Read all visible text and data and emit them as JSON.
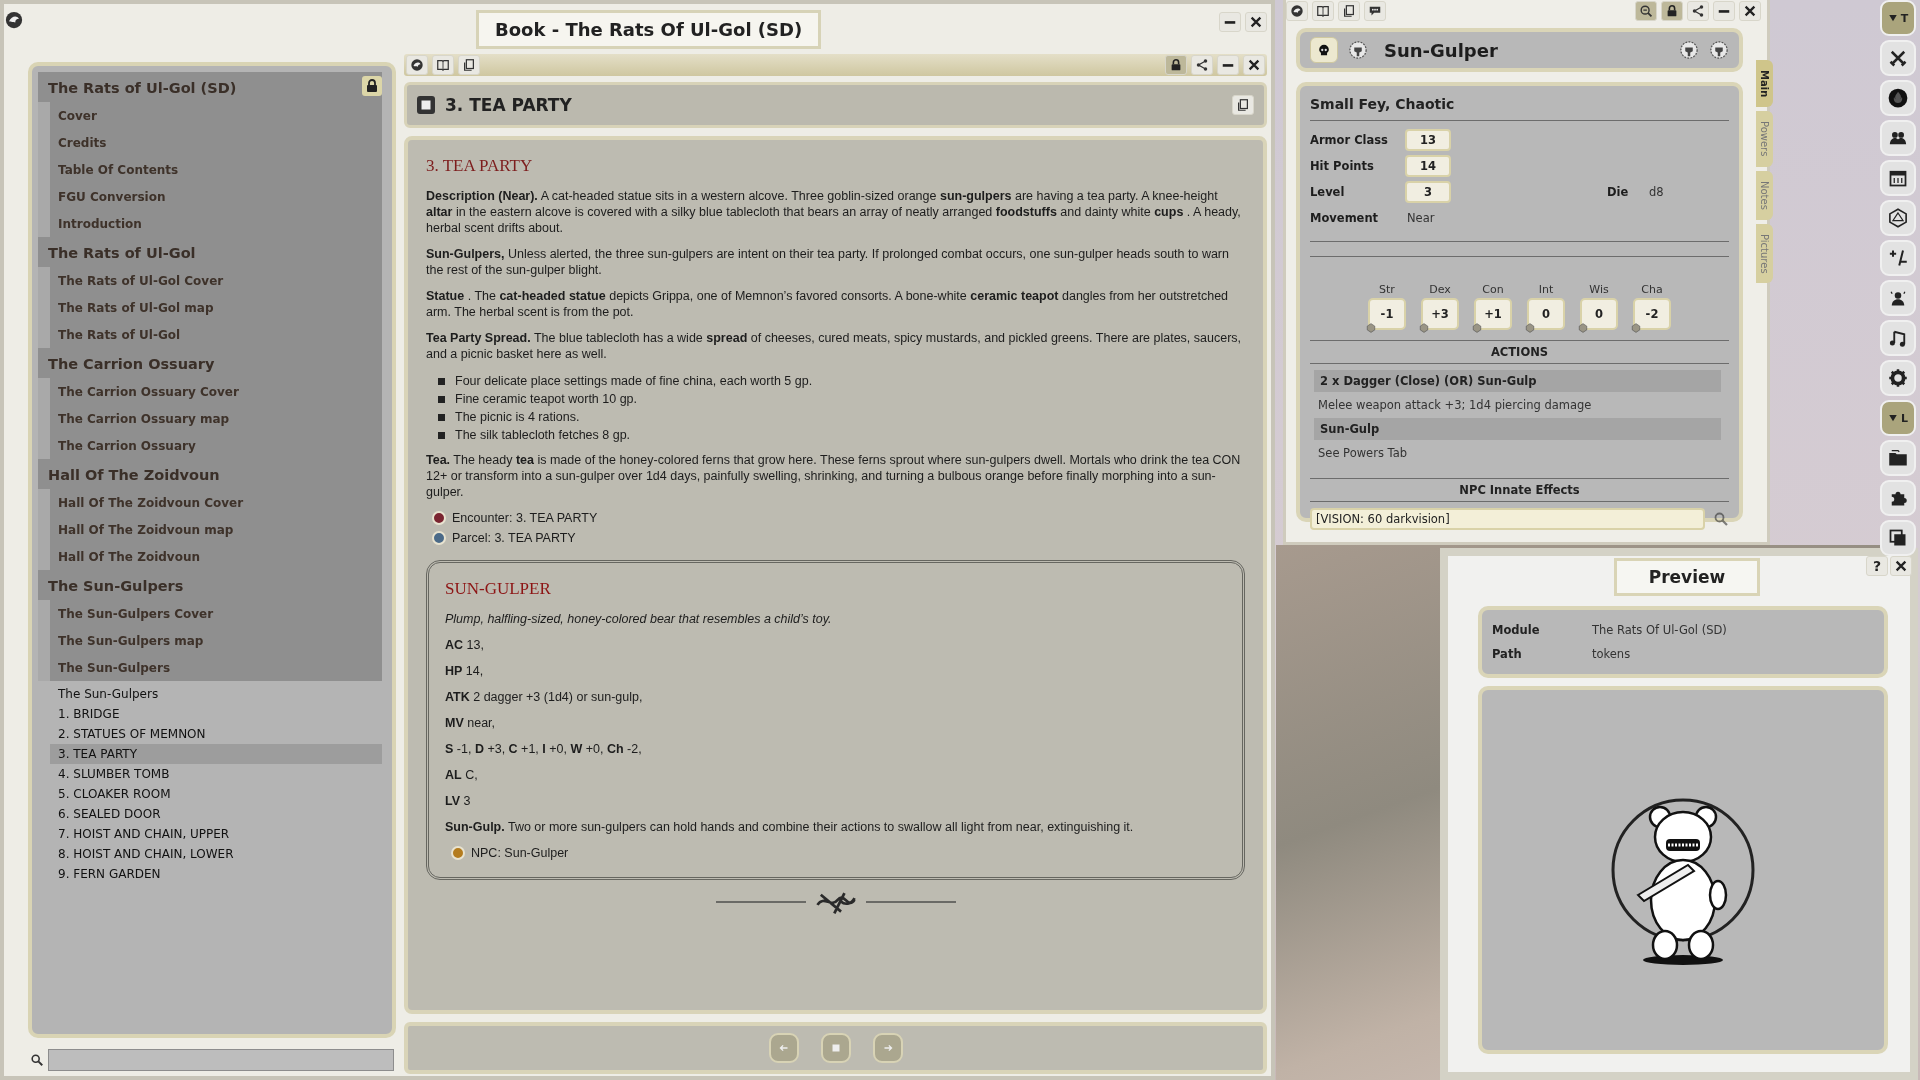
{
  "book": {
    "title": "Book - The Rats Of Ul-Gol (SD)",
    "index": [
      {
        "label": "The Rats of Ul-Gol (SD)",
        "children": [
          {
            "label": "Cover"
          },
          {
            "label": "Credits"
          },
          {
            "label": "Table Of Contents"
          },
          {
            "label": "FGU Conversion"
          },
          {
            "label": "Introduction"
          }
        ]
      },
      {
        "label": "The Rats of Ul-Gol",
        "children": [
          {
            "label": "The Rats of Ul-Gol Cover"
          },
          {
            "label": "The Rats of Ul-Gol map"
          },
          {
            "label": "The Rats of Ul-Gol"
          }
        ]
      },
      {
        "label": "The Carrion Ossuary",
        "children": [
          {
            "label": "The Carrion Ossuary Cover"
          },
          {
            "label": "The Carrion Ossuary map"
          },
          {
            "label": "The Carrion Ossuary"
          }
        ]
      },
      {
        "label": "Hall Of The Zoidvoun",
        "children": [
          {
            "label": "Hall Of The Zoidvoun Cover"
          },
          {
            "label": "Hall Of The Zoidvoun map"
          },
          {
            "label": "Hall Of The Zoidvoun"
          }
        ]
      },
      {
        "label": "The Sun-Gulpers",
        "children": [
          {
            "label": "The Sun-Gulpers Cover"
          },
          {
            "label": "The Sun-Gulpers map"
          },
          {
            "label": "The Sun-Gulpers",
            "children": [
              {
                "label": "The Sun-Gulpers",
                "selected": false
              },
              {
                "label": "1. BRIDGE",
                "selected": false
              },
              {
                "label": "2. STATUES OF MEMNON",
                "selected": false
              },
              {
                "label": "3. TEA PARTY",
                "selected": true
              },
              {
                "label": "4. SLUMBER TOMB",
                "selected": false
              },
              {
                "label": "5. CLOAKER ROOM",
                "selected": false
              },
              {
                "label": "6. SEALED DOOR",
                "selected": false
              },
              {
                "label": "7. HOIST AND CHAIN, UPPER",
                "selected": false
              },
              {
                "label": "8. HOIST AND CHAIN, LOWER",
                "selected": false
              },
              {
                "label": "9. FERN GARDEN",
                "selected": false
              }
            ]
          }
        ]
      }
    ],
    "page": {
      "title": "3. TEA PARTY",
      "blocks": [
        {
          "kind": "heading",
          "text": "3. TEA PARTY"
        },
        {
          "kind": "paragraph",
          "text": "**Description (Near).** A cat-headed statue sits in a western alcove. Three goblin-sized orange **sun-gulpers** are having a tea party. A knee-height **altar** in the eastern alcove is covered with a silky blue tablecloth that bears an array of neatly arranged **foodstuffs** and dainty white **cups** . A heady, herbal scent drifts about."
        },
        {
          "kind": "paragraph",
          "text": "**Sun-Gulpers,** Unless alerted, the three sun-gulpers are intent on their tea party. If prolonged combat occurs, one sun-gulper heads south to warn the rest of the sun-gulper blight."
        },
        {
          "kind": "paragraph",
          "text": "**Statue** . The **cat-headed statue** depicts Grippa, one of Memnon’s favored consorts. A bone-white **ceramic teapot** dangles from her outstretched arm. The herbal scent is from the pot."
        },
        {
          "kind": "paragraph",
          "text": "**Tea Party Spread.** The blue tablecloth has a wide **spread** of cheeses, cured meats, spicy mustards, and pickled greens. There are plates, saucers, and a picnic basket here as well."
        },
        {
          "kind": "list",
          "items": [
            "Four delicate place settings made of fine china, each worth 5 gp.",
            "Fine ceramic teapot worth 10 gp.",
            "The picnic is 4 rations.",
            "The silk tablecloth fetches 8 gp."
          ]
        },
        {
          "kind": "paragraph",
          "text": "**Tea.** The heady **tea** is made of the honey-colored ferns that grow here. These ferns sprout where sun-gulpers dwell. Mortals who drink the tea CON 12+ or transform into a sun-gulper over 1d4 days, painfully swelling, shrinking, and turning a bulbous orange before finally morphing into a sun-gulper."
        },
        {
          "kind": "encounter_link",
          "text": "Encounter: 3. TEA PARTY"
        },
        {
          "kind": "parcel_link",
          "text": "Parcel: 3. TEA PARTY"
        },
        {
          "kind": "statblock",
          "title": "SUN-GULPER",
          "blocks": [
            {
              "kind": "caption",
              "text": "Plump, halfling-sized, honey-colored bear that resembles a child’s toy."
            },
            {
              "kind": "paragraph",
              "text": "**AC** 13,"
            },
            {
              "kind": "paragraph",
              "text": "**HP** 14,"
            },
            {
              "kind": "paragraph",
              "text": "**ATK** 2 dagger +3 (1d4) or sun-gulp,"
            },
            {
              "kind": "paragraph",
              "text": "**MV** near,"
            },
            {
              "kind": "paragraph",
              "text": "**S** -1, **D** +3, **C** +1, **I** +0, **W** +0, **Ch** -2,"
            },
            {
              "kind": "paragraph",
              "text": "**AL** C,"
            },
            {
              "kind": "paragraph",
              "text": "**LV** 3"
            },
            {
              "kind": "paragraph",
              "text": "**Sun-Gulp.** Two or more sun-gulpers can hold hands and combine their actions to swallow all light from near, extinguishing it."
            },
            {
              "kind": "npc_link",
              "text": "NPC: Sun-Gulper"
            }
          ]
        }
      ]
    }
  },
  "npc": {
    "name": "Sun-Gulper",
    "type": "Small Fey, Chaotic",
    "fields": [
      {
        "label": "Armor Class",
        "value": "13",
        "kind": "box"
      },
      {
        "label": "Hit Points",
        "value": "14",
        "kind": "box"
      },
      {
        "label": "Level",
        "value": "3",
        "kind": "box"
      },
      {
        "label": "Movement",
        "value": "Near",
        "kind": "plain"
      }
    ],
    "die": {
      "label": "Die",
      "value": "d8"
    },
    "abilities": [
      {
        "label": "Str",
        "value": "-1"
      },
      {
        "label": "Dex",
        "value": "+3"
      },
      {
        "label": "Con",
        "value": "+1"
      },
      {
        "label": "Int",
        "value": "0"
      },
      {
        "label": "Wis",
        "value": "0"
      },
      {
        "label": "Cha",
        "value": "-2"
      }
    ],
    "actions_title": "ACTIONS",
    "actions": [
      {
        "name": "2 x Dagger (Close) (OR) Sun-Gulp",
        "description": "Melee weapon attack +3; 1d4 piercing damage"
      },
      {
        "name": "Sun-Gulp",
        "description": "See Powers Tab"
      }
    ],
    "effects_title": "NPC Innate Effects",
    "effect": "[VISION: 60 darkvision]",
    "tabs": [
      {
        "label": "Main",
        "selected": true
      },
      {
        "label": "Powers",
        "selected": false
      },
      {
        "label": "Notes",
        "selected": false
      },
      {
        "label": "Pictures",
        "selected": false
      }
    ]
  },
  "preview": {
    "title": "Preview",
    "help": "?",
    "fields": [
      {
        "label": "Module",
        "value": "The Rats Of Ul-Gol (SD)"
      },
      {
        "label": "Path",
        "value": "tokens"
      }
    ]
  },
  "launcher": [
    {
      "label": "T"
    },
    {
      "label": "L"
    }
  ]
}
